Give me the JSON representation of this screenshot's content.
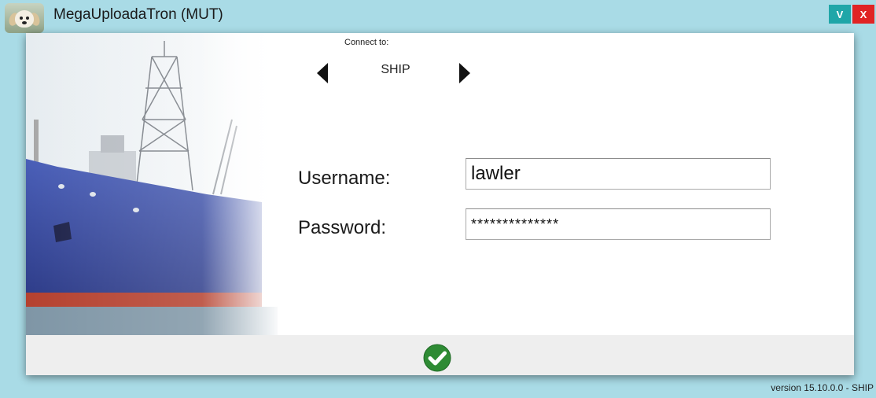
{
  "window": {
    "title": "MegaUploadaTron (MUT)",
    "minimize_label": "V",
    "close_label": "X",
    "app_icon": "puppy-icon"
  },
  "connect": {
    "label": "Connect to:",
    "server": "SHIP",
    "prev_icon": "triangle-left-icon",
    "next_icon": "triangle-right-icon"
  },
  "form": {
    "username_label": "Username:",
    "username_value": "lawler",
    "password_label": "Password:",
    "password_value": "**************"
  },
  "footer": {
    "ok_icon": "green-checkmark-icon",
    "version": "version 15.10.0.0 - SHIP"
  },
  "colors": {
    "background": "#a9dbe6",
    "minimize": "#1fa6a8",
    "close": "#e02424",
    "ok": "#2e8b34"
  }
}
